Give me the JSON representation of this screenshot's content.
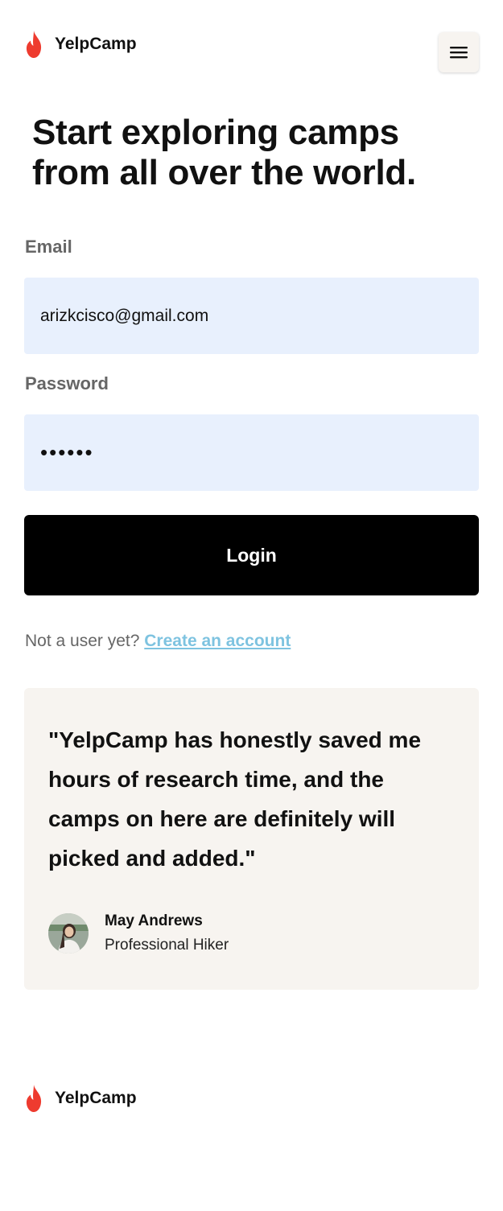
{
  "brand": {
    "name": "YelpCamp",
    "icon": "flame-icon",
    "accent_color": "#ee3b2f"
  },
  "header": {
    "menu_icon": "hamburger-menu-icon"
  },
  "headline": "Start exploring camps from all over the world.",
  "form": {
    "email_label": "Email",
    "email_value": "arizkcisco@gmail.com",
    "password_label": "Password",
    "password_value": "••••••",
    "login_label": "Login"
  },
  "signup": {
    "prompt": "Not a user yet?",
    "link_text": "Create an account",
    "link_color": "#7ec3e0"
  },
  "testimonial": {
    "quote": "\"YelpCamp has honestly saved me hours of research time, and the camps on here are definitely will picked and added.\"",
    "author_name": "May Andrews",
    "author_role": "Professional Hiker"
  },
  "footer": {
    "brand_name": "YelpCamp"
  }
}
